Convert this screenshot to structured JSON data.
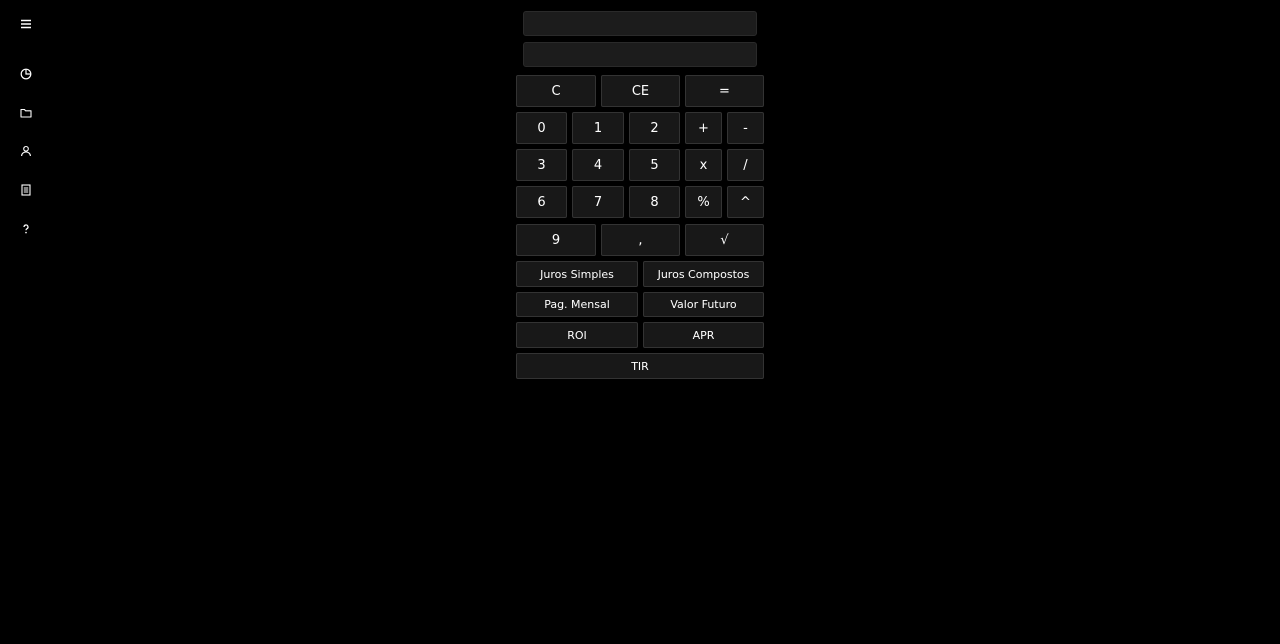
{
  "sidebar": {
    "items": [
      {
        "icon": "menu-icon"
      },
      {
        "icon": "pie-chart-icon"
      },
      {
        "icon": "folder-icon"
      },
      {
        "icon": "user-icon"
      },
      {
        "icon": "receipt-icon"
      },
      {
        "icon": "help-icon"
      }
    ]
  },
  "displays": {
    "expression": "",
    "result": ""
  },
  "keys": {
    "clear": "C",
    "clear_entry": "CE",
    "equals": "=",
    "d0": "0",
    "d1": "1",
    "d2": "2",
    "plus": "+",
    "minus": "-",
    "d3": "3",
    "d4": "4",
    "d5": "5",
    "multiply": "x",
    "divide": "/",
    "d6": "6",
    "d7": "7",
    "d8": "8",
    "percent": "%",
    "power": "^",
    "d9": "9",
    "comma": ",",
    "sqrt": "√"
  },
  "finance": {
    "simple_interest": "Juros Simples",
    "compound_interest": "Juros Compostos",
    "monthly_payment": "Pag. Mensal",
    "future_value": "Valor Futuro",
    "roi": "ROI",
    "apr": "APR",
    "irr": "TIR"
  },
  "colors": {
    "background": "#000000",
    "button": "#181818",
    "button_border": "#333333",
    "text": "#ffffff"
  }
}
